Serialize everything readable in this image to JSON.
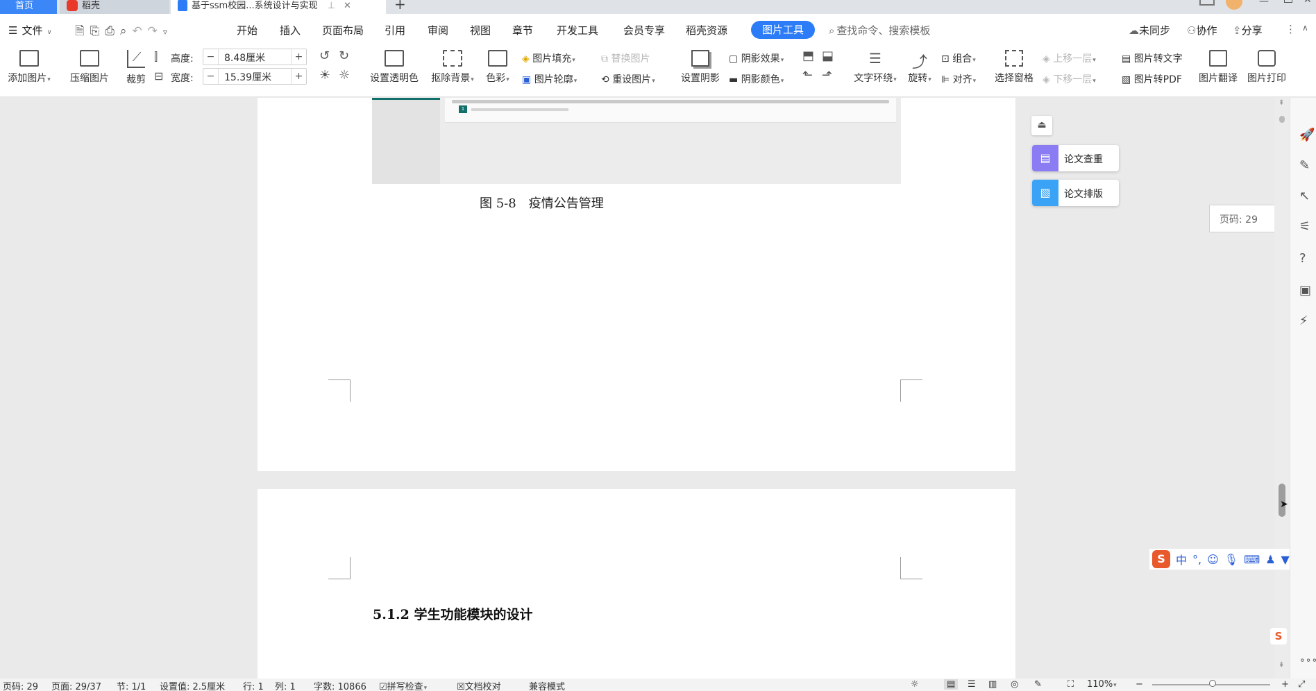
{
  "tabs": {
    "home": "首页",
    "docer": "稻壳",
    "doc": "基于ssm校园...系统设计与实现",
    "add": "+"
  },
  "menu": {
    "file": "文件",
    "items": [
      "开始",
      "插入",
      "页面布局",
      "引用",
      "审阅",
      "视图",
      "章节",
      "开发工具",
      "会员专享",
      "稻壳资源"
    ],
    "active_tool": "图片工具",
    "search_placeholder": "查找命令、搜索模板",
    "unsync": "未同步",
    "collab": "协作",
    "share": "分享"
  },
  "toolbar": {
    "add_picture": "添加图片",
    "compress_picture": "压缩图片",
    "crop": "裁剪",
    "height_label": "高度:",
    "height_value": "8.48厘米",
    "width_label": "宽度:",
    "width_value": "15.39厘米",
    "set_transparent": "设置透明色",
    "remove_bg": "抠除背景",
    "color": "色彩",
    "picture_fill": "图片填充",
    "picture_outline": "图片轮廓",
    "replace_picture": "替换图片",
    "reset_picture": "重设图片",
    "set_shadow": "设置阴影",
    "shadow_effect": "阴影效果",
    "shadow_color": "阴影颜色",
    "text_wrap": "文字环绕",
    "rotate": "旋转",
    "group": "组合",
    "align": "对齐",
    "selection_pane": "选择窗格",
    "bring_forward": "上移一层",
    "send_backward": "下移一层",
    "pic_to_text": "图片转文字",
    "pic_to_pdf": "图片转PDF",
    "pic_translate": "图片翻译",
    "pic_print": "图片打印"
  },
  "document": {
    "caption": "图 5-8　疫情公告管理",
    "heading": "5.1.2 学生功能模块的设计",
    "embedded_pager": "1"
  },
  "side_panel": {
    "paper_check": "论文查重",
    "paper_layout": "论文排版",
    "page_tip": "页码: 29"
  },
  "status": {
    "page_no": "页码: 29",
    "page_count": "页面: 29/37",
    "section": "节: 1/1",
    "setting": "设置值: 2.5厘米",
    "row": "行: 1",
    "col": "列: 1",
    "word_count": "字数: 10866",
    "spell_check": "拼写检查",
    "doc_proof": "文档校对",
    "compat": "兼容模式",
    "zoom": "110%"
  },
  "ime": {
    "lang": "中"
  },
  "colors": {
    "accent": "#2b7cf6",
    "active_tab": "#3c87f7",
    "purple_btn": "#8b7cf3",
    "blue_btn": "#3aa3f5",
    "teal": "#12706b",
    "sogou": "#e8592b"
  }
}
